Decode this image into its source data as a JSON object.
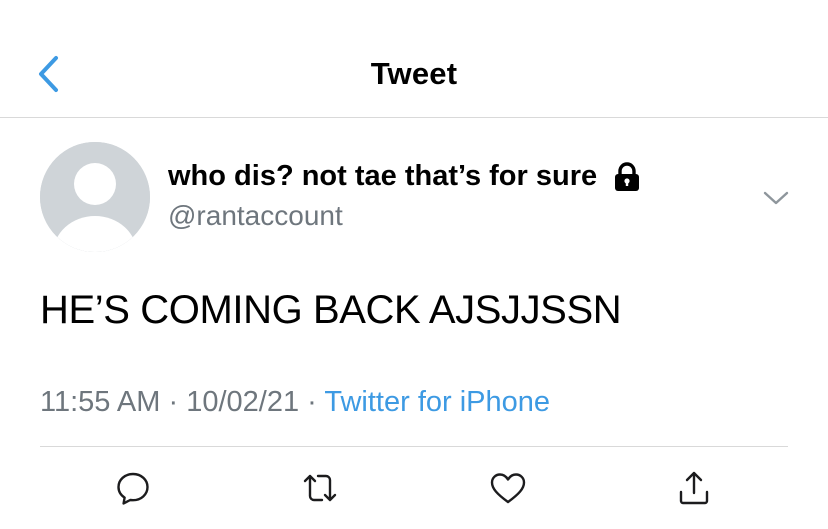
{
  "nav": {
    "title": "Tweet",
    "back_icon": "chevron-left-icon",
    "accent_color": "#3d9ae3"
  },
  "tweet": {
    "author": {
      "display_name": "who dis? not tae that’s for sure",
      "handle": "@rantaccount",
      "protected_icon": "lock-icon",
      "avatar": "default-avatar-silhouette"
    },
    "text": "HE’S COMING BACK AJSJJSSN",
    "time": "11:55 AM",
    "date": "10/02/21",
    "separator": "·",
    "source": "Twitter for iPhone",
    "menu_icon": "chevron-down-icon"
  },
  "actions": [
    {
      "name": "reply",
      "icon": "reply-icon"
    },
    {
      "name": "retweet",
      "icon": "retweet-icon"
    },
    {
      "name": "like",
      "icon": "heart-icon"
    },
    {
      "name": "share",
      "icon": "share-icon"
    }
  ],
  "colors": {
    "secondary_text": "#6e767d",
    "divider": "#d9d9d9",
    "icon": "#1c1c1e"
  }
}
